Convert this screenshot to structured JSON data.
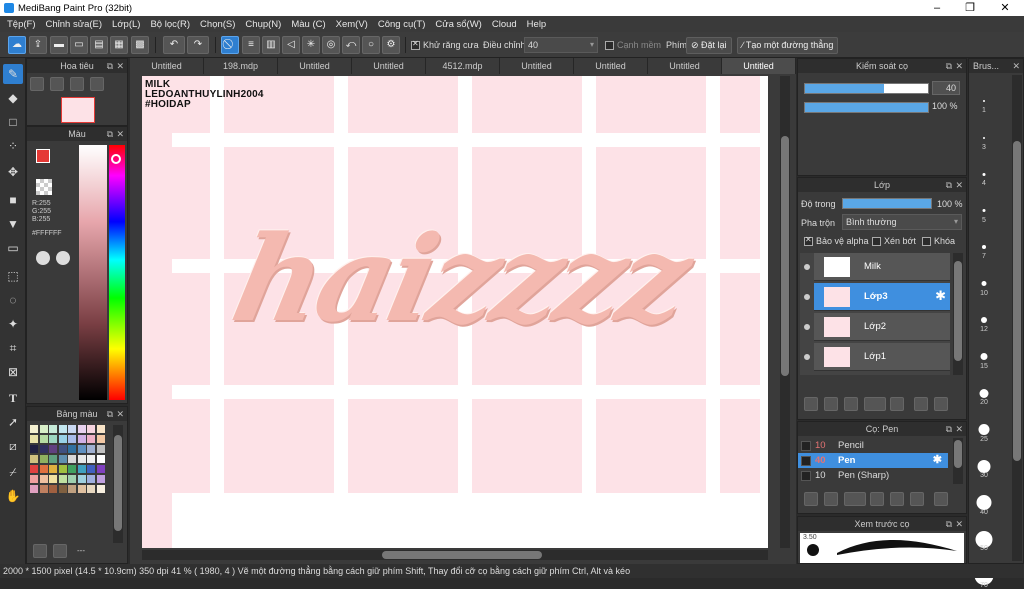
{
  "window": {
    "title": "MediBang Paint Pro (32bit)",
    "min": "–",
    "max": "❐",
    "close": "✕"
  },
  "menu": [
    "Tệp(F)",
    "Chỉnh sửa(E)",
    "Lớp(L)",
    "Bộ lọc(R)",
    "Chọn(S)",
    "Chụp(N)",
    "Màu (C)",
    "Xem(V)",
    "Công cụ(T)",
    "Cửa sổ(W)",
    "Cloud",
    "Help"
  ],
  "toolbar": {
    "antialias_label": "Khử răng cưa",
    "adjust_label": "Điều chỉnh",
    "adjust_value": "40",
    "smooth_edge_label": "Cạnh mềm",
    "key_label": "Phím",
    "reset_label": "Đặt lại",
    "line_label": "Tạo một đường thẳng"
  },
  "navigator": {
    "title": "Hoa tiêu"
  },
  "color_panel": {
    "title": "Màu",
    "r": "R:255",
    "g": "G:255",
    "b": "B:255",
    "hex": "#FFFFFF",
    "fg": "#e53935",
    "bg": "#f8bbc0"
  },
  "palette": {
    "title": "Bảng màu",
    "extra": "---"
  },
  "tabs": [
    "Untitled",
    "198.mdp",
    "Untitled",
    "Untitled",
    "4512.mdp",
    "Untitled",
    "Untitled",
    "Untitled",
    "Untitled"
  ],
  "active_tab": 8,
  "canvas": {
    "line1": "MILK",
    "line2": "LEDOANTHUYLINH2004",
    "line3": "#HOIDAP",
    "art_text": "haizzzz",
    "pink": "#fde2e7",
    "grid": "#ffffff"
  },
  "brush_control": {
    "title": "Kiểm soát cọ",
    "size": "40",
    "opacity": "100 %",
    "size_fill": 0.64,
    "opacity_fill": 1.0
  },
  "layer_panel": {
    "title": "Lớp",
    "opacity_label": "Độ trong",
    "opacity_value": "100 %",
    "blend_label": "Pha trộn",
    "blend_value": "Bình thường",
    "protect_alpha": "Bảo vệ alpha",
    "clipping": "Xén bớt",
    "lock": "Khóa",
    "layers": [
      {
        "name": "Milk",
        "selected": false
      },
      {
        "name": "Lớp3",
        "selected": true
      },
      {
        "name": "Lớp2",
        "selected": false
      },
      {
        "name": "Lớp1",
        "selected": false
      }
    ]
  },
  "brush_panel": {
    "title": "Cọ: Pen",
    "brushes": [
      {
        "size": "10",
        "name": "Pencil",
        "selected": false
      },
      {
        "size": "40",
        "name": "Pen",
        "selected": true
      },
      {
        "size": "10",
        "name": "Pen (Sharp)",
        "selected": false
      }
    ]
  },
  "preview": {
    "title": "Xem trước cọ",
    "size": "3.50"
  },
  "brush_size_panel": {
    "title": "Brus...",
    "sizes": [
      "1",
      "3",
      "4",
      "5",
      "7",
      "10",
      "12",
      "15",
      "20",
      "25",
      "30",
      "40",
      "50",
      "70"
    ]
  },
  "status": "2000 * 1500 pixel   (14.5 * 10.9cm)   350 dpi   41 %   ( 1980, 4 )   Vẽ một đường thẳng bằng cách giữ phím Shift, Thay đổi cỡ cọ bằng cách giữ phím Ctrl, Alt và kéo"
}
